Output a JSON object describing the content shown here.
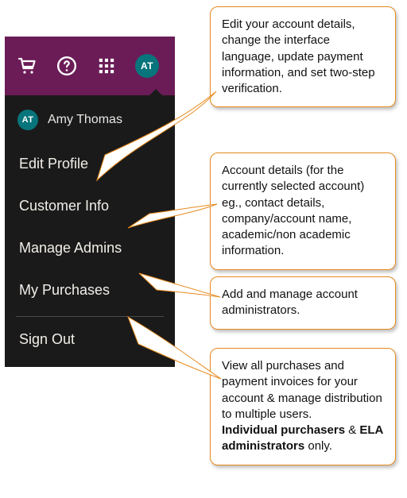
{
  "topbar": {
    "avatar_initials": "AT"
  },
  "dropdown": {
    "user_initials": "AT",
    "user_name": "Amy Thomas",
    "items": {
      "edit_profile": "Edit Profile",
      "customer_info": "Customer Info",
      "manage_admins": "Manage Admins",
      "my_purchases": "My Purchases",
      "sign_out": "Sign Out"
    }
  },
  "callouts": {
    "edit_profile": "Edit your account details, change the interface language, update payment information, and set two-step verification.",
    "customer_info": "Account details (for the currently selected account) eg., contact details, company/account name, academic/non academic information.",
    "manage_admins": "Add and manage account administrators.",
    "my_purchases_pre": "View all purchases and payment invoices for your account & manage distribution to multiple users.",
    "my_purchases_b1": "Individual purchasers",
    "my_purchases_mid": " & ",
    "my_purchases_b2": "ELA administrators",
    "my_purchases_post": " only."
  }
}
